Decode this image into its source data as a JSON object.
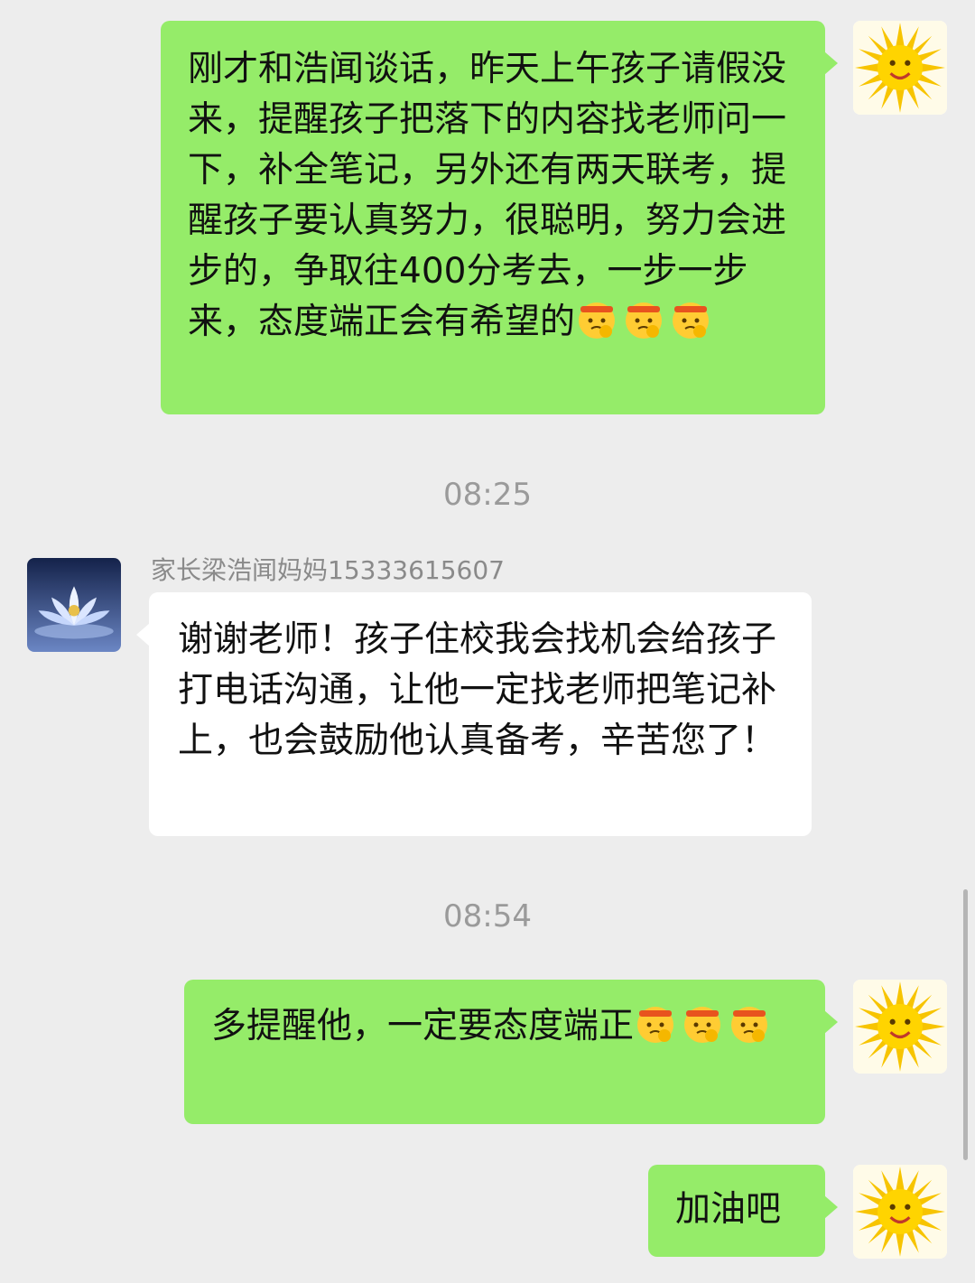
{
  "messages": [
    {
      "side": "mine",
      "text": "刚才和浩闻谈话，昨天上午孩子请假没来，提醒孩子把落下的内容找老师问一下，补全笔记，另外还有两天联考，提醒孩子要认真努力，很聪明，努力会进步的，争取往400分考去，一步一步来，态度端正会有希望的",
      "emojis": [
        "determined-emoji",
        "determined-emoji",
        "determined-emoji"
      ],
      "avatar": "sun-avatar"
    },
    {
      "time": "08:25"
    },
    {
      "side": "theirs",
      "sender": "家长梁浩闻妈妈15333615607",
      "text": "谢谢老师！孩子住校我会找机会给孩子打电话沟通，让他一定找老师把笔记补上，也会鼓励他认真备考，辛苦您了！",
      "avatar": "lotus-avatar"
    },
    {
      "time": "08:54"
    },
    {
      "side": "mine",
      "text": "多提醒他，一定要态度端正",
      "emojis": [
        "determined-emoji",
        "determined-emoji",
        "determined-emoji"
      ],
      "avatar": "sun-avatar"
    },
    {
      "side": "mine",
      "text": "加油吧",
      "avatar": "sun-avatar"
    }
  ],
  "colors": {
    "mine_bubble": "#95ec69",
    "theirs_bubble": "#ffffff",
    "background": "#ededed"
  }
}
